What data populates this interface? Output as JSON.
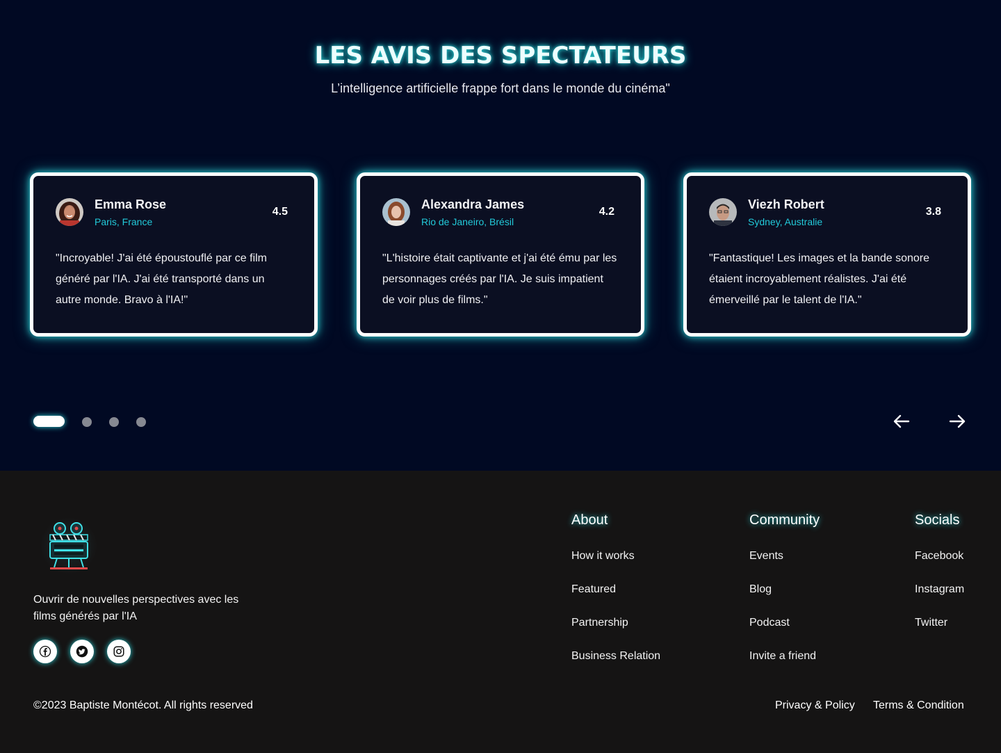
{
  "reviews": {
    "title": "LES AVIS DES SPECTATEURS",
    "subtitle": "L’intelligence artificielle  frappe fort dans le monde du cinéma\"",
    "cards": [
      {
        "name": "Emma Rose",
        "location": "Paris, France",
        "rating": "4.5",
        "quote": "\"Incroyable! J'ai été époustouflé par ce film généré par l'IA. J'ai été transporté dans un autre monde. Bravo à l'IA!\""
      },
      {
        "name": "Alexandra James",
        "location": "Rio de Janeiro, Brésil",
        "rating": "4.2",
        "quote": "\"L'histoire était captivante et j'ai été ému par les personnages créés par l'IA. Je suis impatient de voir plus de films.\""
      },
      {
        "name": "Viezh Robert",
        "location": "Sydney, Australie",
        "rating": "3.8",
        "quote": "\"Fantastique! Les images et la bande sonore étaient incroyablement réalistes. J'ai été émerveillé par le talent de l'IA.\""
      }
    ],
    "pagination": {
      "total": 4,
      "active_index": 0
    },
    "icons": {
      "prev": "arrow-left-icon",
      "next": "arrow-right-icon"
    }
  },
  "footer": {
    "tagline": "Ouvrir de nouvelles perspectives avec les films générés par l'IA",
    "social_icons": [
      "facebook-icon",
      "twitter-icon",
      "instagram-icon"
    ],
    "columns": [
      {
        "heading": "About",
        "links": [
          "How it works",
          "Featured",
          "Partnership",
          "Business Relation"
        ]
      },
      {
        "heading": "Community",
        "links": [
          "Events",
          "Blog",
          "Podcast",
          "Invite a friend"
        ]
      },
      {
        "heading": "Socials",
        "links": [
          "Facebook",
          "Instagram",
          "Twitter"
        ]
      }
    ],
    "copyright": "©2023 Baptiste Montécot. All rights reserved",
    "legal": {
      "privacy": "Privacy & Policy",
      "terms": "Terms & Condition"
    }
  },
  "colors": {
    "section_bg": "#010923",
    "footer_bg": "#151414",
    "card_bg": "#0b0f22",
    "accent_cyan": "#22c9d9",
    "glow": "#2bd0d6"
  }
}
